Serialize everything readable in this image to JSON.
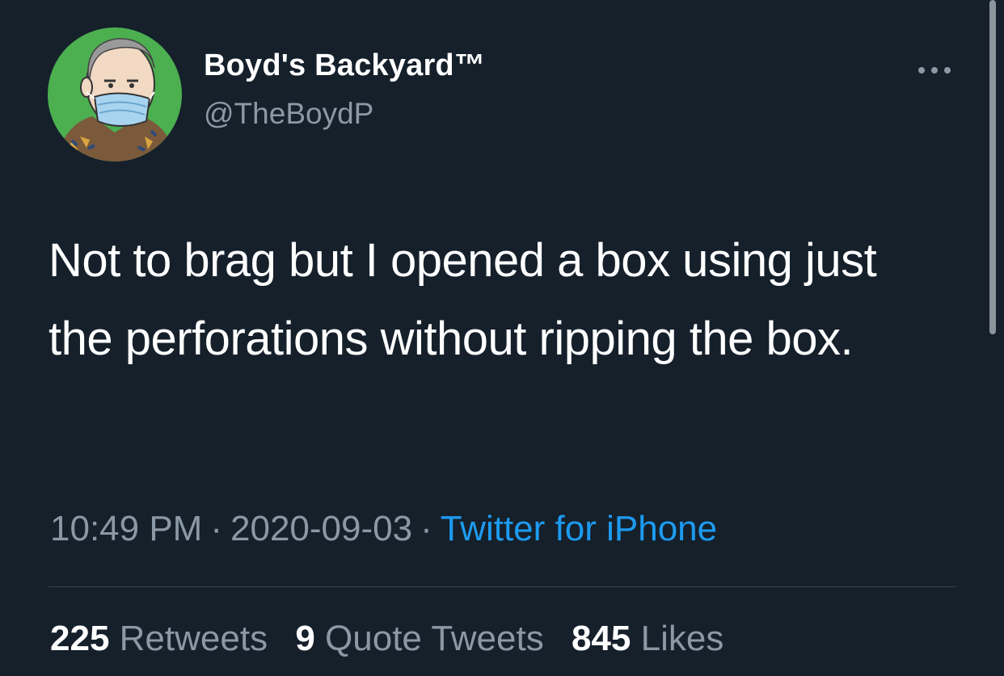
{
  "tweet": {
    "author": {
      "display_name": "Boyd's Backyard™",
      "handle": "@TheBoydP"
    },
    "text": "Not to brag but I opened a box using just the perforations without ripping the box.",
    "time": "10:49 PM",
    "date": "2020-09-03",
    "separator": "·",
    "source": "Twitter for iPhone",
    "stats": {
      "retweets_count": "225",
      "retweets_label": "Retweets",
      "quote_tweets_count": "9",
      "quote_tweets_label": "Quote Tweets",
      "likes_count": "845",
      "likes_label": "Likes"
    }
  },
  "icons": {
    "more": "more-horizontal-icon"
  },
  "colors": {
    "background": "#15202b",
    "primary_text": "#ffffff",
    "secondary_text": "#8b98a5",
    "link": "#1d9bf0",
    "divider": "#38444d",
    "avatar_bg": "#4caf50"
  }
}
